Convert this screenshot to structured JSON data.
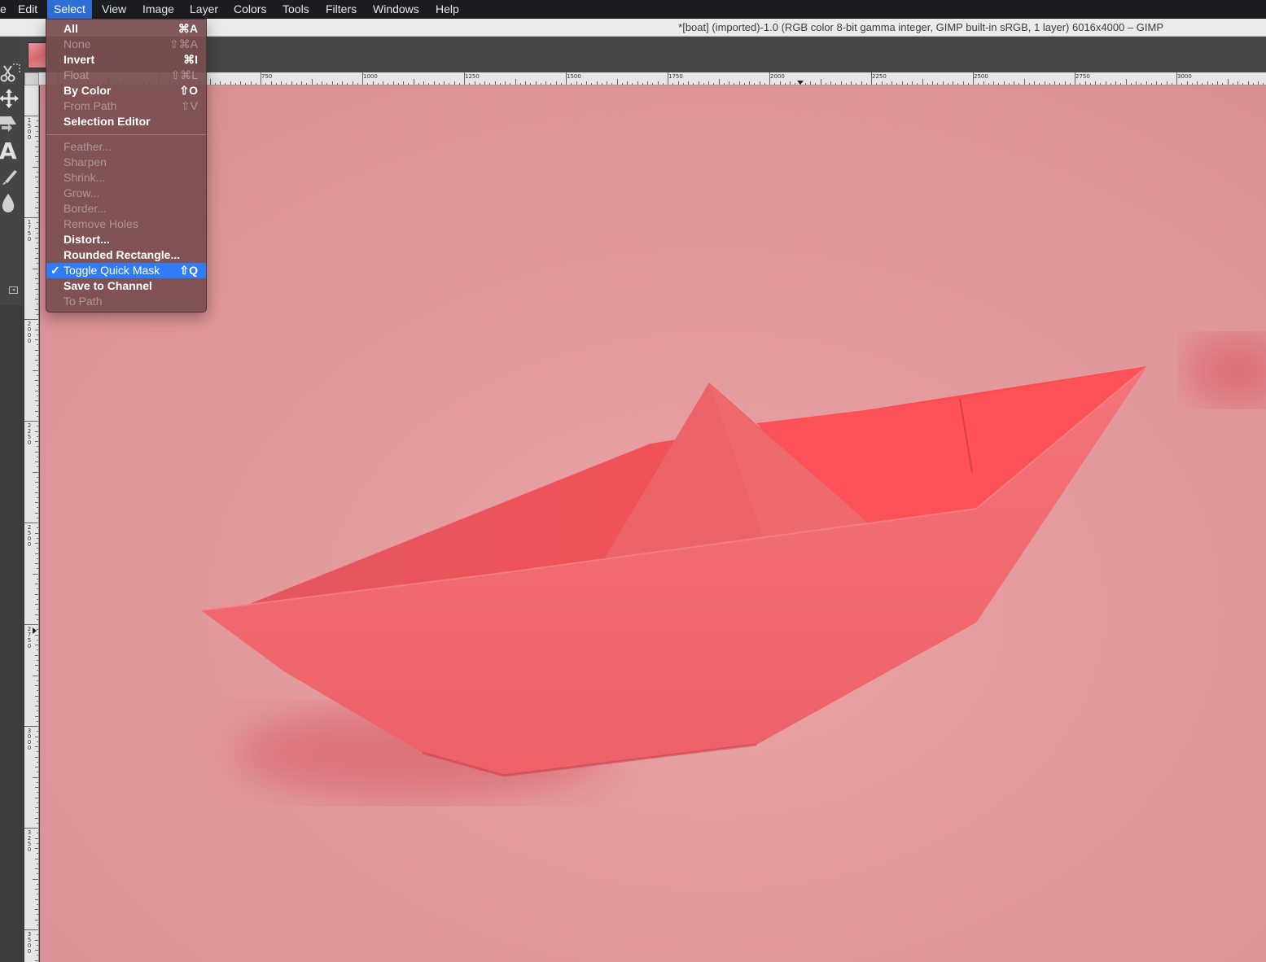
{
  "menubar": {
    "items": [
      {
        "label": "e"
      },
      {
        "label": "Edit"
      },
      {
        "label": "Select"
      },
      {
        "label": "View"
      },
      {
        "label": "Image"
      },
      {
        "label": "Layer"
      },
      {
        "label": "Colors"
      },
      {
        "label": "Tools"
      },
      {
        "label": "Filters"
      },
      {
        "label": "Windows"
      },
      {
        "label": "Help"
      }
    ],
    "active": "Select",
    "active_color": "#2f6fd9"
  },
  "window": {
    "title": "*[boat] (imported)-1.0 (RGB color 8-bit gamma integer, GIMP built-in sRGB, 1 layer) 6016x4000 – GIMP"
  },
  "select_menu": {
    "items": [
      {
        "label": "All",
        "shortcut": "⌘A",
        "enabled": true
      },
      {
        "label": "None",
        "shortcut": "⇧⌘A",
        "enabled": false
      },
      {
        "label": "Invert",
        "shortcut": "⌘I",
        "enabled": true
      },
      {
        "label": "Float",
        "shortcut": "⇧⌘L",
        "enabled": false
      },
      {
        "label": "By Color",
        "shortcut": "⇧O",
        "enabled": true
      },
      {
        "label": "From Path",
        "shortcut": "⇧V",
        "enabled": false
      },
      {
        "label": "Selection Editor",
        "shortcut": "",
        "enabled": true
      },
      {
        "label": "Feather...",
        "shortcut": "",
        "enabled": false
      },
      {
        "label": "Sharpen",
        "shortcut": "",
        "enabled": false
      },
      {
        "label": "Shrink...",
        "shortcut": "",
        "enabled": false
      },
      {
        "label": "Grow...",
        "shortcut": "",
        "enabled": false
      },
      {
        "label": "Border...",
        "shortcut": "",
        "enabled": false
      },
      {
        "label": "Remove Holes",
        "shortcut": "",
        "enabled": false
      },
      {
        "label": "Distort...",
        "shortcut": "",
        "enabled": true
      },
      {
        "label": "Rounded Rectangle...",
        "shortcut": "",
        "enabled": true
      },
      {
        "label": "Toggle Quick Mask",
        "shortcut": "⇧Q",
        "enabled": true,
        "checked": true,
        "highlighted": true
      },
      {
        "label": "Save to Channel",
        "shortcut": "",
        "enabled": true
      },
      {
        "label": "To Path",
        "shortcut": "",
        "enabled": false
      }
    ],
    "check_mark": "✓",
    "highlight_color": "#2f7cf6"
  },
  "toolbox": {
    "tools": [
      "scissors-select-icon",
      "move-icon",
      "transform-icon",
      "text-icon",
      "paintbrush-icon",
      "dodge-burn-icon"
    ],
    "text_tool_glyph": "A"
  },
  "rulers": {
    "horizontal_labels": [
      "750",
      "1000",
      "1250",
      "1500",
      "1750",
      "2000",
      "2250",
      "2500",
      "2750",
      "3000"
    ],
    "vertical_labels": [
      "1500",
      "1750",
      "2000",
      "2250",
      "2500",
      "2750",
      "3000",
      "3250",
      "3500"
    ]
  },
  "canvas": {
    "image": "pink paper boat on pink background",
    "background_color": "#e0969a",
    "boat_color": "#f0676c"
  }
}
